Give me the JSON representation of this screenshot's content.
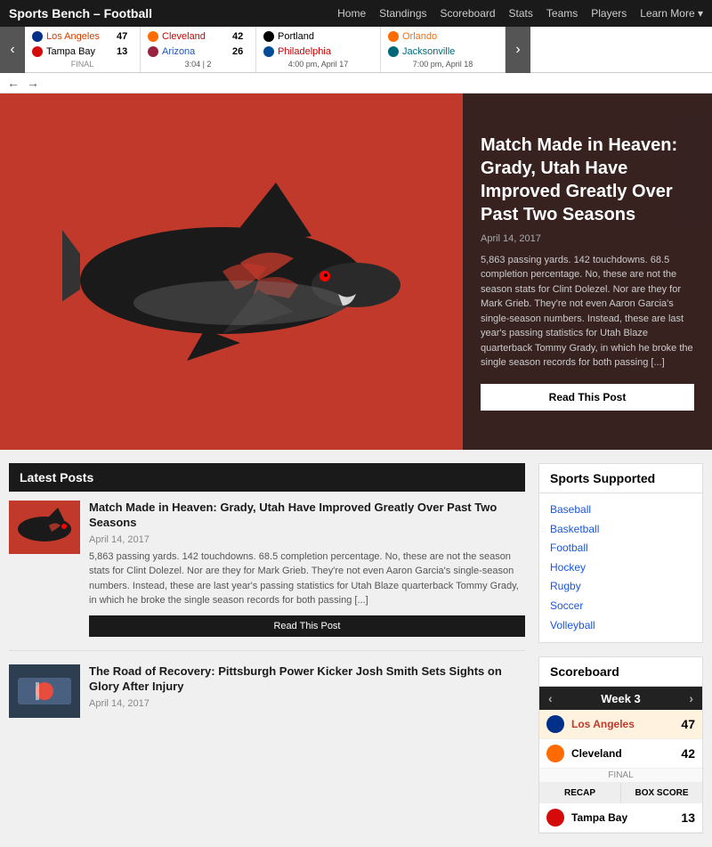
{
  "nav": {
    "logo": "Sports Bench – Football",
    "links": [
      "Home",
      "Standings",
      "Scoreboard",
      "Stats",
      "Teams",
      "Players",
      "Learn More ▾"
    ]
  },
  "scores": [
    {
      "team1": {
        "name": "Los Angeles",
        "score": "47",
        "logo_color": "#003087"
      },
      "team2": {
        "name": "Tampa Bay",
        "score": "13",
        "logo_color": "#D50A0A"
      },
      "status": "FINAL",
      "info": ""
    },
    {
      "team1": {
        "name": "Cleveland",
        "score": "42",
        "logo_color": "#311D00"
      },
      "team2": {
        "name": "Arizona",
        "score": "26",
        "logo_color": "#97233F"
      },
      "status": "",
      "info": "3:04 | 2"
    },
    {
      "team1": {
        "name": "Portland",
        "score": "",
        "logo_color": "#000"
      },
      "team2": {
        "name": "Philadelphia",
        "score": "",
        "logo_color": "#004C97"
      },
      "status": "",
      "info": "4:00 pm, April 17"
    },
    {
      "team1": {
        "name": "Orlando",
        "score": "",
        "logo_color": "#FF6B00"
      },
      "team2": {
        "name": "Jacksonville",
        "score": "",
        "logo_color": "#00A86B"
      },
      "status": "",
      "info": "7:00 pm, April 18"
    }
  ],
  "hero": {
    "title": "Match Made in Heaven: Grady, Utah Have Improved Greatly Over Past Two Seasons",
    "date": "April 14, 2017",
    "excerpt": "5,863 passing yards. 142 touchdowns. 68.5 completion percentage. No, these are not the season stats for Clint Dolezel. Nor are they for Mark Grieb. They're not even Aaron Garcia's single-season numbers. Instead, these are last year's passing statistics for Utah Blaze quarterback Tommy Grady, in which he broke the single season records for both passing [...]",
    "btn": "Read This Post"
  },
  "latest_posts": {
    "header": "Latest Posts",
    "posts": [
      {
        "title": "Match Made in Heaven: Grady, Utah Have Improved Greatly Over Past Two Seasons",
        "date": "April 14, 2017",
        "excerpt": "5,863 passing yards. 142 touchdowns. 68.5 completion percentage. No, these are not the season stats for Clint Dolezel. Nor are they for Mark Grieb. They're not even Aaron Garcia's single-season numbers. Instead, these are last year's passing statistics for Utah Blaze quarterback Tommy Grady, in which he broke the single season records for both passing [...]",
        "btn": "Read This Post"
      },
      {
        "title": "The Road of Recovery: Pittsburgh Power Kicker Josh Smith Sets Sights on Glory After Injury",
        "date": "April 14, 2017",
        "excerpt": ""
      }
    ]
  },
  "sports_supported": {
    "header": "Sports Supported",
    "sports": [
      "Baseball",
      "Basketball",
      "Football",
      "Hockey",
      "Rugby",
      "Soccer",
      "Volleyball"
    ]
  },
  "scoreboard": {
    "header": "Scoreboard",
    "week_label": "Week 3",
    "teams": [
      {
        "name": "Los Angeles",
        "score": "47",
        "logo_color": "#003087"
      },
      {
        "name": "Cleveland",
        "score": "42",
        "logo_color": "#311D00"
      }
    ],
    "status": "FINAL",
    "recap_btn": "RECAP",
    "boxscore_btn": "BOX SCORE",
    "next_team": {
      "name": "Tampa Bay",
      "score": "13",
      "logo_color": "#D50A0A"
    }
  }
}
